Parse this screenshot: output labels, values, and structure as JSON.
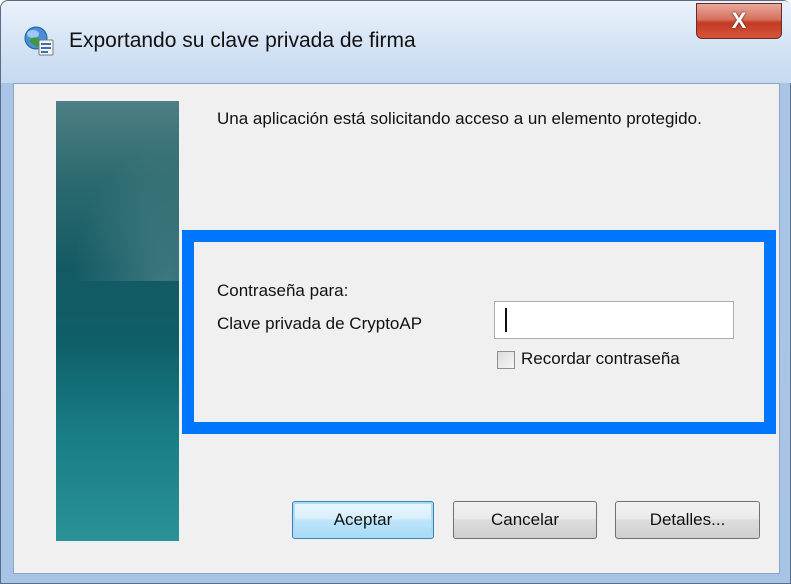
{
  "window": {
    "title": "Exportando su clave privada de firma",
    "close_glyph": "X"
  },
  "dialog": {
    "message": "Una aplicación está solicitando acceso a un elemento protegido.",
    "password_for_label": "Contraseña para:",
    "key_label": "Clave privada de CryptoAP",
    "password_value": "",
    "remember_label": "Recordar contraseña",
    "remember_checked": false
  },
  "buttons": {
    "ok": "Aceptar",
    "cancel": "Cancelar",
    "details": "Detalles..."
  },
  "colors": {
    "highlight_border": "#0076ff",
    "banner": "#145a63"
  },
  "icons": {
    "title": "security-key-icon",
    "close": "close-icon"
  }
}
